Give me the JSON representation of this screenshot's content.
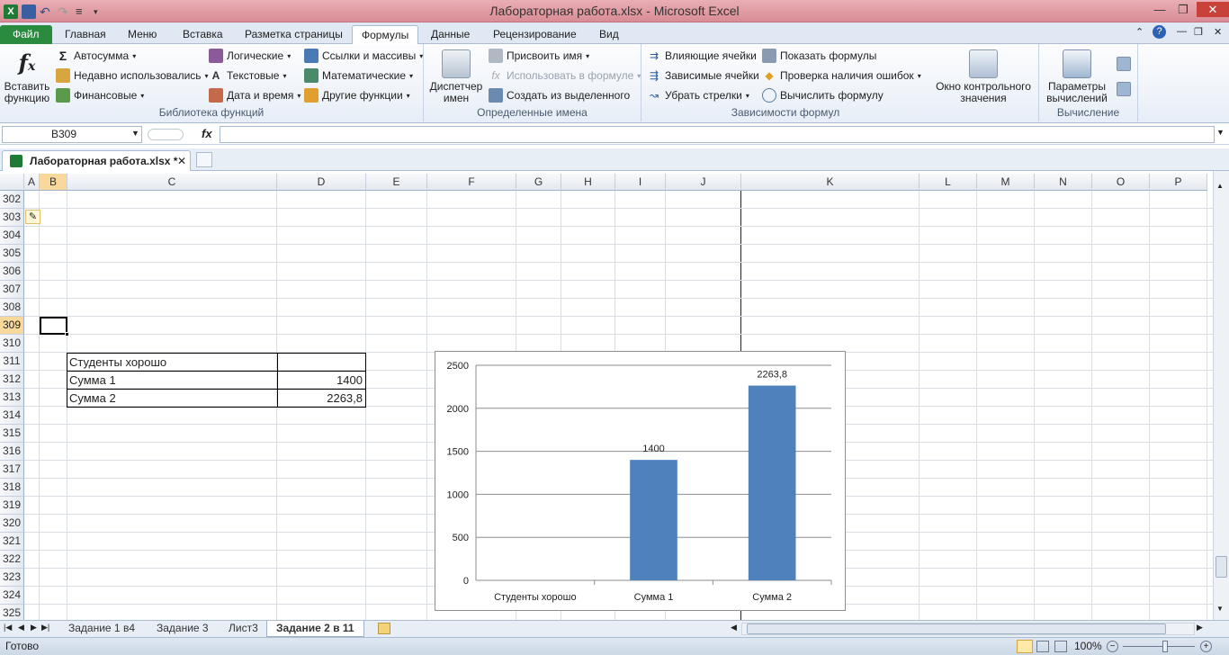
{
  "window": {
    "title": "Лабораторная работа.xlsx - Microsoft Excel"
  },
  "tabs": [
    {
      "label": "Файл"
    },
    {
      "label": "Главная"
    },
    {
      "label": "Меню"
    },
    {
      "label": "Вставка"
    },
    {
      "label": "Разметка страницы"
    },
    {
      "label": "Формулы"
    },
    {
      "label": "Данные"
    },
    {
      "label": "Рецензирование"
    },
    {
      "label": "Вид"
    }
  ],
  "ribbon": {
    "insert_function": "Вставить функцию",
    "library": {
      "label": "Библиотека функций",
      "autosum": "Автосумма",
      "recent": "Недавно использовались",
      "financial": "Финансовые",
      "logical": "Логические",
      "text": "Текстовые",
      "datetime": "Дата и время",
      "lookup": "Ссылки и массивы",
      "math": "Математические",
      "other": "Другие функции"
    },
    "names": {
      "label": "Определенные имена",
      "manager": "Диспетчер имен",
      "assign": "Присвоить имя",
      "use_in_formula": "Использовать в формуле",
      "create_from_selection": "Создать из выделенного"
    },
    "audit": {
      "label": "Зависимости формул",
      "precedents": "Влияющие ячейки",
      "dependents": "Зависимые ячейки",
      "remove_arrows": "Убрать стрелки",
      "show_formulas": "Показать формулы",
      "error_check": "Проверка наличия ошибок",
      "evaluate": "Вычислить формулу",
      "watch": "Окно контрольного значения"
    },
    "calc": {
      "label": "Вычисление",
      "options": "Параметры вычислений"
    }
  },
  "formula_bar": {
    "name_box": "B309",
    "fx": "fx",
    "value": ""
  },
  "workbook_tab": "Лабораторная работа.xlsx *",
  "columns": [
    "A",
    "B",
    "C",
    "D",
    "E",
    "F",
    "G",
    "H",
    "I",
    "J",
    "K",
    "L",
    "M",
    "N",
    "O",
    "P"
  ],
  "rows": [
    "302",
    "303",
    "304",
    "305",
    "306",
    "307",
    "308",
    "309",
    "310",
    "311",
    "312",
    "313",
    "314",
    "315",
    "316",
    "317",
    "318",
    "319",
    "320",
    "321",
    "322",
    "323",
    "324",
    "325"
  ],
  "table": {
    "c311": "Студенты хорошо",
    "c312": "Сумма 1",
    "d312": "1400",
    "c313": "Сумма 2",
    "d313": "2263,8"
  },
  "chart_data": {
    "type": "bar",
    "categories": [
      "Студенты хорошо",
      "Сумма 1",
      "Сумма 2"
    ],
    "values": [
      0,
      1400,
      2263.8
    ],
    "data_labels": [
      "",
      "1400",
      "2263,8"
    ],
    "ylim": [
      0,
      2500
    ],
    "yticks": [
      "0",
      "500",
      "1000",
      "1500",
      "2000",
      "2500"
    ],
    "grid": true,
    "color": "#4f81bd"
  },
  "sheets": [
    {
      "label": "Задание 1 в4"
    },
    {
      "label": "Задание 3"
    },
    {
      "label": "Лист3"
    },
    {
      "label": "Задание 2 в 11"
    }
  ],
  "status": {
    "ready": "Готово",
    "zoom": "100%"
  },
  "colors": {
    "file_tab": "#2a8a3e",
    "title": "#d98c95",
    "selection": "#f9d99b"
  }
}
